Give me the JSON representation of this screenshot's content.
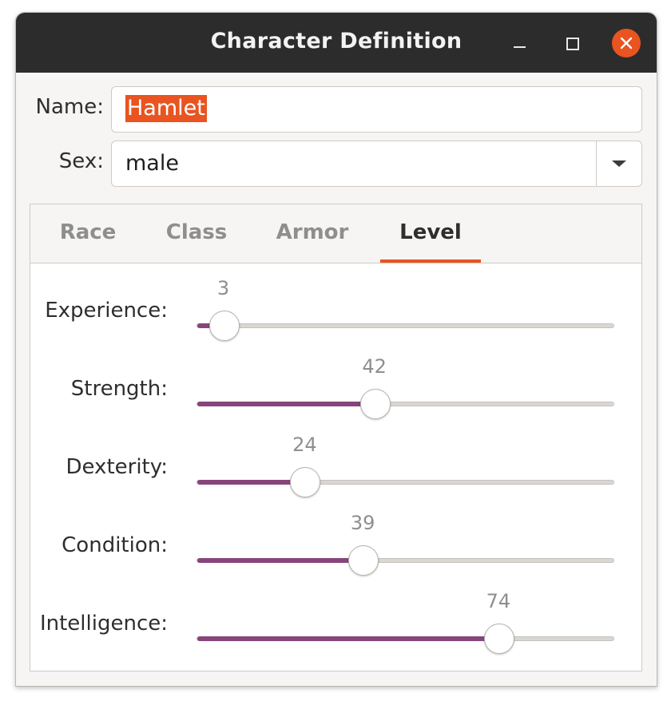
{
  "window": {
    "title": "Character Definition",
    "controls": [
      "minimize-icon",
      "maximize-icon",
      "close-icon"
    ],
    "accent_color": "#e95420"
  },
  "form": {
    "name_label": "Name:",
    "name_value": "Hamlet",
    "sex_label": "Sex:",
    "sex_value": "male"
  },
  "tabs": [
    {
      "label": "Race",
      "active": false
    },
    {
      "label": "Class",
      "active": false
    },
    {
      "label": "Armor",
      "active": false
    },
    {
      "label": "Level",
      "active": true
    }
  ],
  "sliders": {
    "min": 0,
    "max": 100,
    "fill_color": "#87457b",
    "items": [
      {
        "label": "Experience:",
        "value": 3,
        "value_text": "3"
      },
      {
        "label": "Strength:",
        "value": 42,
        "value_text": "42"
      },
      {
        "label": "Dexterity:",
        "value": 24,
        "value_text": "24"
      },
      {
        "label": "Condition:",
        "value": 39,
        "value_text": "39"
      },
      {
        "label": "Intelligence:",
        "value": 74,
        "value_text": "74"
      }
    ]
  }
}
